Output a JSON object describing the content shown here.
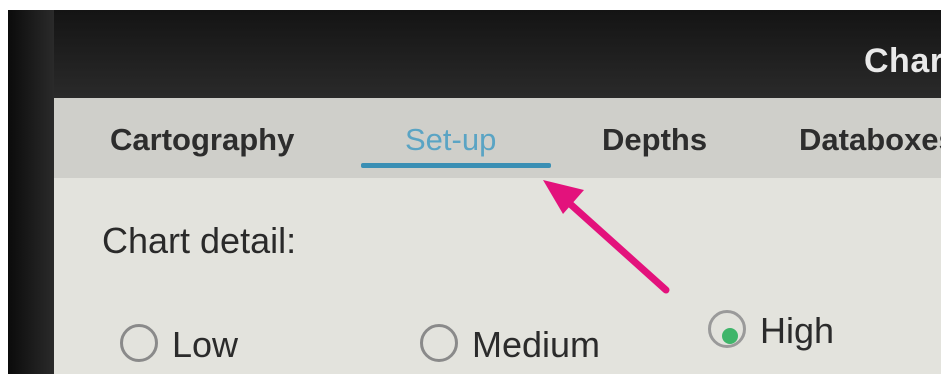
{
  "window": {
    "title": "Chart s"
  },
  "tabs": [
    {
      "label": "Cartography",
      "active": false
    },
    {
      "label": "Set-up",
      "active": true
    },
    {
      "label": "Depths",
      "active": false
    },
    {
      "label": "Databoxes",
      "active": false
    }
  ],
  "section": {
    "label": "Chart detail:"
  },
  "chart_detail_options": [
    {
      "label": "Low",
      "selected": false
    },
    {
      "label": "Medium",
      "selected": false
    },
    {
      "label": "High",
      "selected": true
    }
  ],
  "colors": {
    "accent": "#3a8fb4",
    "active_tab_text": "#5aa4c4",
    "radio_selected": "#3fb56a",
    "annotation_arrow": "#e3127c"
  }
}
